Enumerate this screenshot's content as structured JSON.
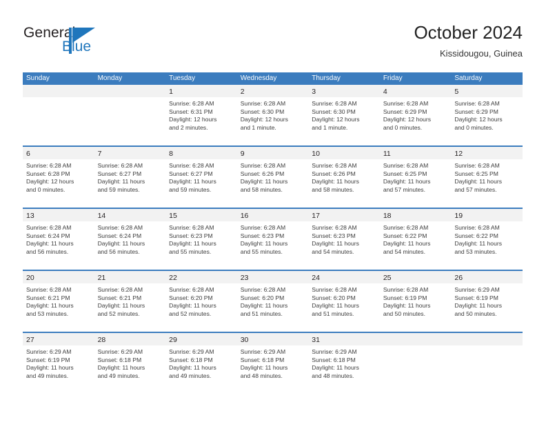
{
  "brand": {
    "name_top": "General",
    "name_bottom": "Blue",
    "accent_color": "#1f76bc"
  },
  "header": {
    "title": "October 2024",
    "location": "Kissidougou, Guinea"
  },
  "theme": {
    "header_blue": "#3b7cbe",
    "band_gray": "#f2f2f2",
    "text": "#3c3c3c"
  },
  "calendar": {
    "weekday_headers": [
      "Sunday",
      "Monday",
      "Tuesday",
      "Wednesday",
      "Thursday",
      "Friday",
      "Saturday"
    ],
    "weeks": [
      [
        {
          "day": "",
          "lines": []
        },
        {
          "day": "",
          "lines": []
        },
        {
          "day": "1",
          "lines": [
            "Sunrise: 6:28 AM",
            "Sunset: 6:31 PM",
            "Daylight: 12 hours",
            "and 2 minutes."
          ]
        },
        {
          "day": "2",
          "lines": [
            "Sunrise: 6:28 AM",
            "Sunset: 6:30 PM",
            "Daylight: 12 hours",
            "and 1 minute."
          ]
        },
        {
          "day": "3",
          "lines": [
            "Sunrise: 6:28 AM",
            "Sunset: 6:30 PM",
            "Daylight: 12 hours",
            "and 1 minute."
          ]
        },
        {
          "day": "4",
          "lines": [
            "Sunrise: 6:28 AM",
            "Sunset: 6:29 PM",
            "Daylight: 12 hours",
            "and 0 minutes."
          ]
        },
        {
          "day": "5",
          "lines": [
            "Sunrise: 6:28 AM",
            "Sunset: 6:29 PM",
            "Daylight: 12 hours",
            "and 0 minutes."
          ]
        }
      ],
      [
        {
          "day": "6",
          "lines": [
            "Sunrise: 6:28 AM",
            "Sunset: 6:28 PM",
            "Daylight: 12 hours",
            "and 0 minutes."
          ]
        },
        {
          "day": "7",
          "lines": [
            "Sunrise: 6:28 AM",
            "Sunset: 6:27 PM",
            "Daylight: 11 hours",
            "and 59 minutes."
          ]
        },
        {
          "day": "8",
          "lines": [
            "Sunrise: 6:28 AM",
            "Sunset: 6:27 PM",
            "Daylight: 11 hours",
            "and 59 minutes."
          ]
        },
        {
          "day": "9",
          "lines": [
            "Sunrise: 6:28 AM",
            "Sunset: 6:26 PM",
            "Daylight: 11 hours",
            "and 58 minutes."
          ]
        },
        {
          "day": "10",
          "lines": [
            "Sunrise: 6:28 AM",
            "Sunset: 6:26 PM",
            "Daylight: 11 hours",
            "and 58 minutes."
          ]
        },
        {
          "day": "11",
          "lines": [
            "Sunrise: 6:28 AM",
            "Sunset: 6:25 PM",
            "Daylight: 11 hours",
            "and 57 minutes."
          ]
        },
        {
          "day": "12",
          "lines": [
            "Sunrise: 6:28 AM",
            "Sunset: 6:25 PM",
            "Daylight: 11 hours",
            "and 57 minutes."
          ]
        }
      ],
      [
        {
          "day": "13",
          "lines": [
            "Sunrise: 6:28 AM",
            "Sunset: 6:24 PM",
            "Daylight: 11 hours",
            "and 56 minutes."
          ]
        },
        {
          "day": "14",
          "lines": [
            "Sunrise: 6:28 AM",
            "Sunset: 6:24 PM",
            "Daylight: 11 hours",
            "and 56 minutes."
          ]
        },
        {
          "day": "15",
          "lines": [
            "Sunrise: 6:28 AM",
            "Sunset: 6:23 PM",
            "Daylight: 11 hours",
            "and 55 minutes."
          ]
        },
        {
          "day": "16",
          "lines": [
            "Sunrise: 6:28 AM",
            "Sunset: 6:23 PM",
            "Daylight: 11 hours",
            "and 55 minutes."
          ]
        },
        {
          "day": "17",
          "lines": [
            "Sunrise: 6:28 AM",
            "Sunset: 6:23 PM",
            "Daylight: 11 hours",
            "and 54 minutes."
          ]
        },
        {
          "day": "18",
          "lines": [
            "Sunrise: 6:28 AM",
            "Sunset: 6:22 PM",
            "Daylight: 11 hours",
            "and 54 minutes."
          ]
        },
        {
          "day": "19",
          "lines": [
            "Sunrise: 6:28 AM",
            "Sunset: 6:22 PM",
            "Daylight: 11 hours",
            "and 53 minutes."
          ]
        }
      ],
      [
        {
          "day": "20",
          "lines": [
            "Sunrise: 6:28 AM",
            "Sunset: 6:21 PM",
            "Daylight: 11 hours",
            "and 53 minutes."
          ]
        },
        {
          "day": "21",
          "lines": [
            "Sunrise: 6:28 AM",
            "Sunset: 6:21 PM",
            "Daylight: 11 hours",
            "and 52 minutes."
          ]
        },
        {
          "day": "22",
          "lines": [
            "Sunrise: 6:28 AM",
            "Sunset: 6:20 PM",
            "Daylight: 11 hours",
            "and 52 minutes."
          ]
        },
        {
          "day": "23",
          "lines": [
            "Sunrise: 6:28 AM",
            "Sunset: 6:20 PM",
            "Daylight: 11 hours",
            "and 51 minutes."
          ]
        },
        {
          "day": "24",
          "lines": [
            "Sunrise: 6:28 AM",
            "Sunset: 6:20 PM",
            "Daylight: 11 hours",
            "and 51 minutes."
          ]
        },
        {
          "day": "25",
          "lines": [
            "Sunrise: 6:28 AM",
            "Sunset: 6:19 PM",
            "Daylight: 11 hours",
            "and 50 minutes."
          ]
        },
        {
          "day": "26",
          "lines": [
            "Sunrise: 6:29 AM",
            "Sunset: 6:19 PM",
            "Daylight: 11 hours",
            "and 50 minutes."
          ]
        }
      ],
      [
        {
          "day": "27",
          "lines": [
            "Sunrise: 6:29 AM",
            "Sunset: 6:19 PM",
            "Daylight: 11 hours",
            "and 49 minutes."
          ]
        },
        {
          "day": "28",
          "lines": [
            "Sunrise: 6:29 AM",
            "Sunset: 6:18 PM",
            "Daylight: 11 hours",
            "and 49 minutes."
          ]
        },
        {
          "day": "29",
          "lines": [
            "Sunrise: 6:29 AM",
            "Sunset: 6:18 PM",
            "Daylight: 11 hours",
            "and 49 minutes."
          ]
        },
        {
          "day": "30",
          "lines": [
            "Sunrise: 6:29 AM",
            "Sunset: 6:18 PM",
            "Daylight: 11 hours",
            "and 48 minutes."
          ]
        },
        {
          "day": "31",
          "lines": [
            "Sunrise: 6:29 AM",
            "Sunset: 6:18 PM",
            "Daylight: 11 hours",
            "and 48 minutes."
          ]
        },
        {
          "day": "",
          "lines": []
        },
        {
          "day": "",
          "lines": []
        }
      ]
    ]
  }
}
